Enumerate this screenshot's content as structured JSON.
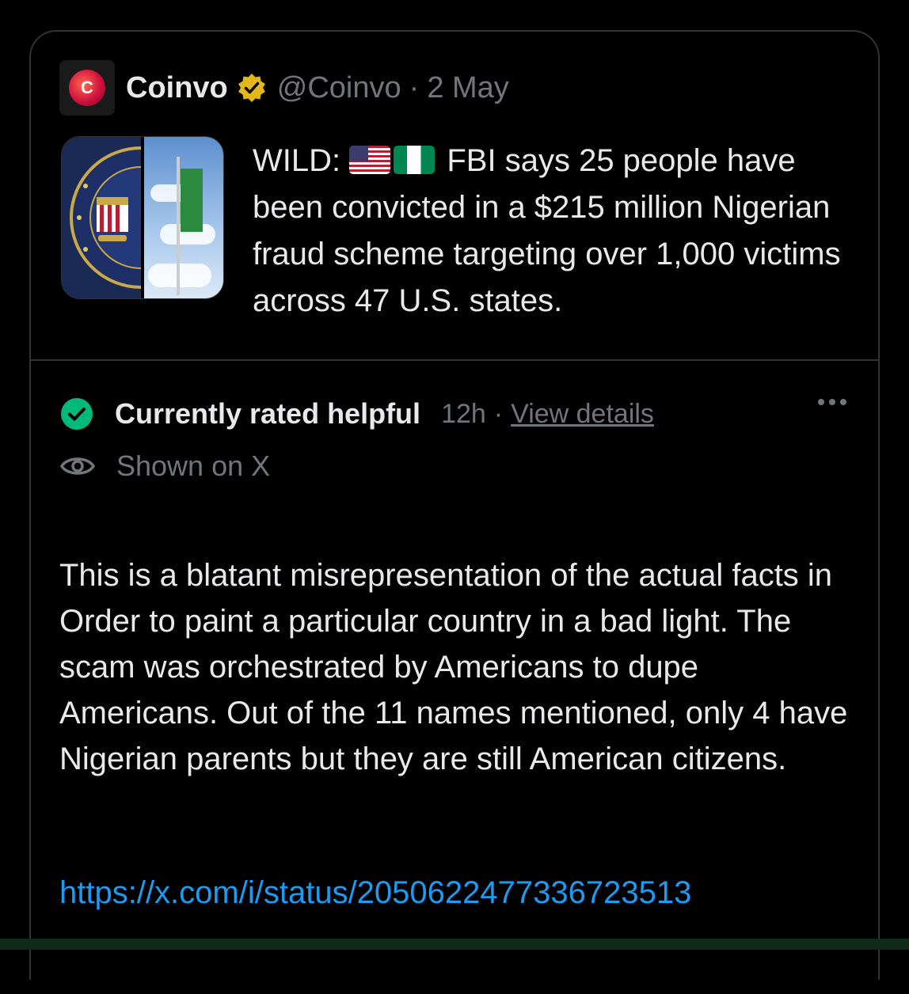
{
  "tweet": {
    "author_name": "Coinvo",
    "handle": "@Coinvo",
    "separator": "·",
    "time": "2 May",
    "avatar_letter": "C",
    "text_prefix": "WILD:",
    "text_body": "FBI says 25 people have been convicted in a $215 million Nigerian fraud scheme targeting over 1,000 victims across 47 U.S. states.",
    "flags": [
      "us-flag-icon",
      "nigeria-flag-icon"
    ]
  },
  "note": {
    "status_title": "Currently rated helpful",
    "status_time": "12h",
    "separator": "·",
    "view_details": "View details",
    "shown_on": "Shown on X",
    "body": "This is a blatant misrepresentation of the actual facts in Order to paint a particular country in a bad light. The scam was orchestrated by Americans to dupe Americans. Out of the 11 names mentioned, only 4 have Nigerian parents but they are still American citizens.",
    "link": "https://x.com/i/status/2050622477336723513"
  },
  "icons": {
    "verified": "verified-badge-icon",
    "check": "check-circle-icon",
    "eye": "eye-icon",
    "more": "more-options-icon"
  },
  "colors": {
    "background": "#000000",
    "text": "#e7e9ea",
    "muted": "#71767b",
    "link": "#1d9bf0",
    "helpful_green": "#00ba7c",
    "verified_gold": "#e2b719"
  }
}
